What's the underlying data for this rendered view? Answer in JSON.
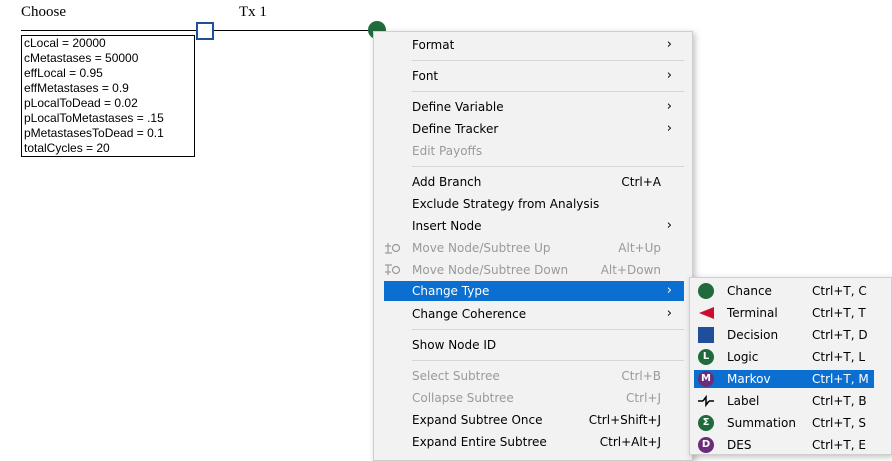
{
  "tree": {
    "root_label": "Choose",
    "branch_label": "Tx 1",
    "variables": [
      "cLocal = 20000",
      "cMetastases = 50000",
      "effLocal = 0.95",
      "effMetastases = 0.9",
      "pLocalToDead = 0.02",
      "pLocalToMetastases = .15",
      "pMetastasesToDead = 0.1",
      "totalCycles = 20"
    ]
  },
  "context_menu": {
    "items": [
      {
        "label": "Format",
        "shortcut": "",
        "submenu": true,
        "disabled": false
      },
      {
        "label": "Font",
        "shortcut": "",
        "submenu": true,
        "disabled": false
      },
      {
        "label": "Define Variable",
        "shortcut": "",
        "submenu": true,
        "disabled": false
      },
      {
        "label": "Define Tracker",
        "shortcut": "",
        "submenu": true,
        "disabled": false
      },
      {
        "label": "Edit Payoffs",
        "shortcut": "",
        "submenu": false,
        "disabled": true
      },
      {
        "label": "Add Branch",
        "shortcut": "Ctrl+A",
        "submenu": false,
        "disabled": false
      },
      {
        "label": "Exclude Strategy from Analysis",
        "shortcut": "",
        "submenu": false,
        "disabled": false
      },
      {
        "label": "Insert Node",
        "shortcut": "",
        "submenu": true,
        "disabled": false
      },
      {
        "label": "Move Node/Subtree Up",
        "shortcut": "Alt+Up",
        "submenu": false,
        "disabled": true
      },
      {
        "label": "Move Node/Subtree Down",
        "shortcut": "Alt+Down",
        "submenu": false,
        "disabled": true
      },
      {
        "label": "Change Type",
        "shortcut": "",
        "submenu": true,
        "disabled": false
      },
      {
        "label": "Change Coherence",
        "shortcut": "",
        "submenu": true,
        "disabled": false
      },
      {
        "label": "Show Node ID",
        "shortcut": "",
        "submenu": false,
        "disabled": false
      },
      {
        "label": "Select Subtree",
        "shortcut": "Ctrl+B",
        "submenu": false,
        "disabled": true
      },
      {
        "label": "Collapse Subtree",
        "shortcut": "Ctrl+J",
        "submenu": false,
        "disabled": true
      },
      {
        "label": "Expand Subtree Once",
        "shortcut": "Ctrl+Shift+J",
        "submenu": false,
        "disabled": false
      },
      {
        "label": "Expand Entire Subtree",
        "shortcut": "Ctrl+Alt+J",
        "submenu": false,
        "disabled": false
      }
    ]
  },
  "type_submenu": {
    "items": [
      {
        "label": "Chance",
        "shortcut": "Ctrl+T, C",
        "icon": "chance-icon",
        "letter": ""
      },
      {
        "label": "Terminal",
        "shortcut": "Ctrl+T, T",
        "icon": "terminal-icon",
        "letter": ""
      },
      {
        "label": "Decision",
        "shortcut": "Ctrl+T, D",
        "icon": "decision-icon",
        "letter": ""
      },
      {
        "label": "Logic",
        "shortcut": "Ctrl+T, L",
        "icon": "logic-icon",
        "letter": "L"
      },
      {
        "label": "Markov",
        "shortcut": "Ctrl+T, M",
        "icon": "markov-icon",
        "letter": "M"
      },
      {
        "label": "Label",
        "shortcut": "Ctrl+T, B",
        "icon": "label-icon",
        "letter": ""
      },
      {
        "label": "Summation",
        "shortcut": "Ctrl+T, S",
        "icon": "summation-icon",
        "letter": "Σ"
      },
      {
        "label": "DES",
        "shortcut": "Ctrl+T, E",
        "icon": "des-icon",
        "letter": "D"
      }
    ]
  },
  "colors": {
    "highlight": "#0a6fd1",
    "chance": "#1f6b3c",
    "terminal": "#c8102e",
    "decision": "#1f4e9b",
    "logic": "#1f6b3c",
    "markov": "#6b2c7a",
    "summation": "#1f6b3c",
    "des": "#6b2c7a"
  }
}
